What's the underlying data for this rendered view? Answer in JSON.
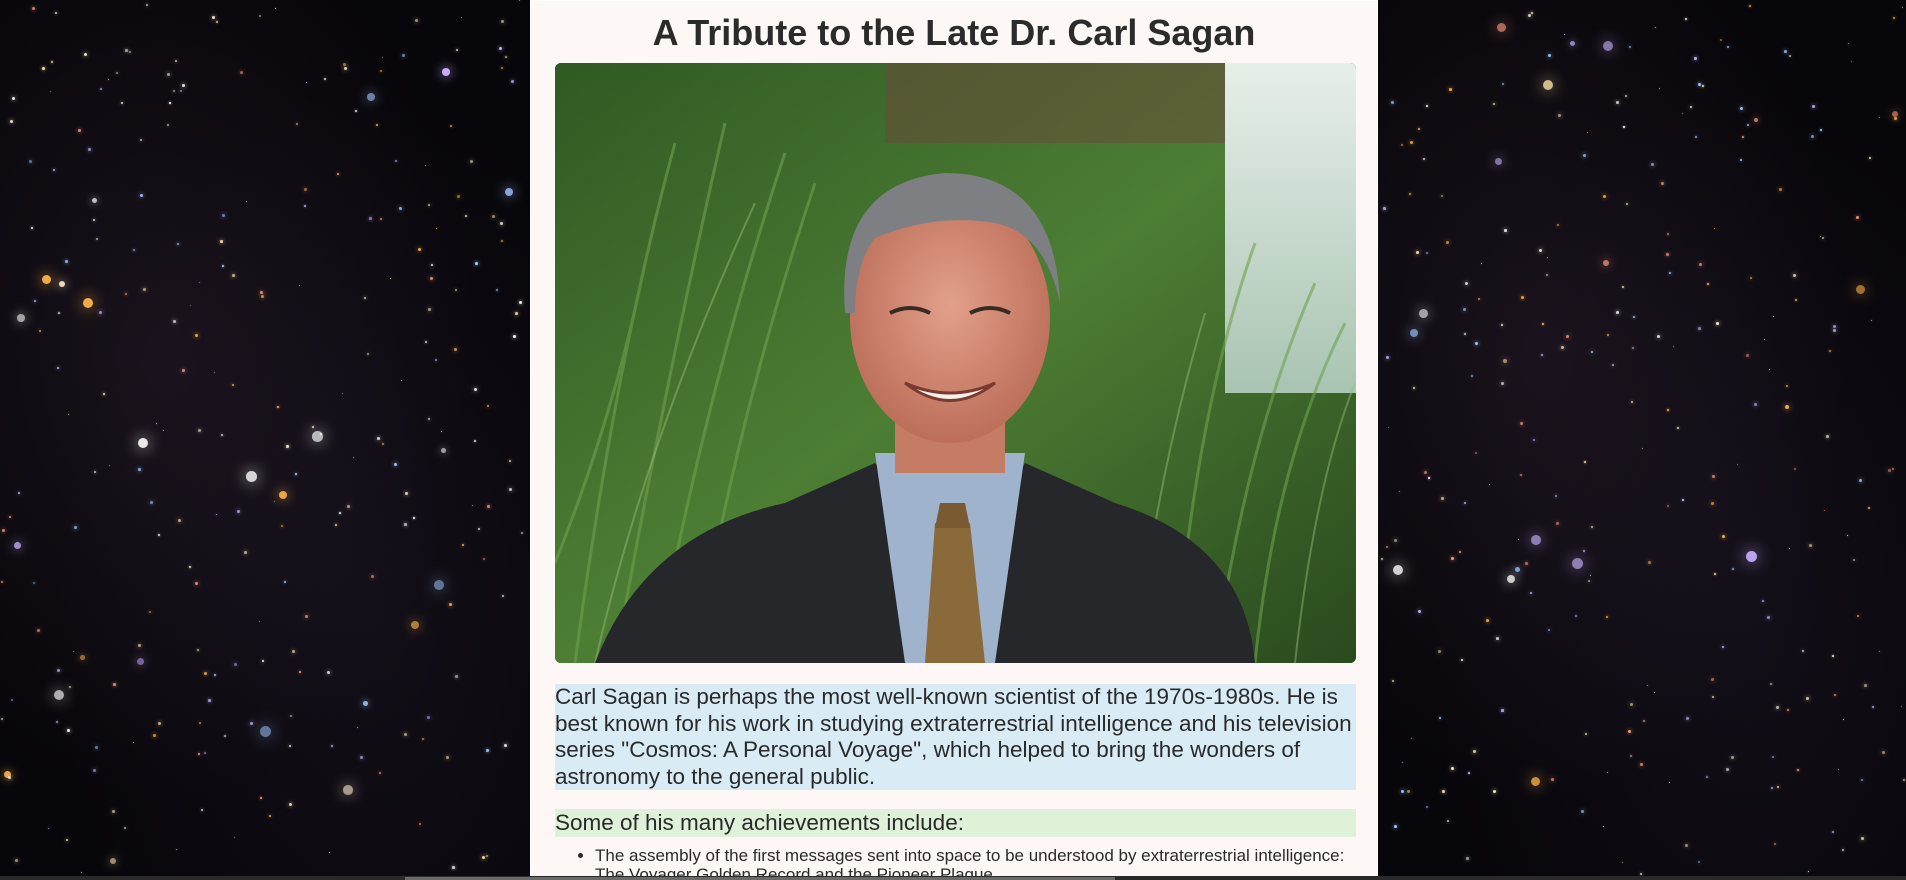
{
  "page": {
    "title": "A Tribute to the Late Dr. Carl Sagan"
  },
  "photo": {
    "subject": "portrait-photo"
  },
  "intro": {
    "text": "Carl Sagan is perhaps the most well-known scientist of the 1970s-1980s. He is best known for his work in studying extraterrestrial intelligence and his television series \"Cosmos: A Personal Voyage\", which helped to bring the wonders of astronomy to the general public."
  },
  "achievements": {
    "heading": "Some of his many achievements include:",
    "items": [
      "The assembly of the first messages sent into space to be understood by extraterrestrial intelligence: The Voyager Golden Record and the Pioneer Plaque"
    ]
  },
  "colors": {
    "content_background": "#fdf8f5",
    "intro_highlight": "#d9ecf6",
    "heading_highlight": "#dff1d8",
    "space_background": "#07060a"
  }
}
